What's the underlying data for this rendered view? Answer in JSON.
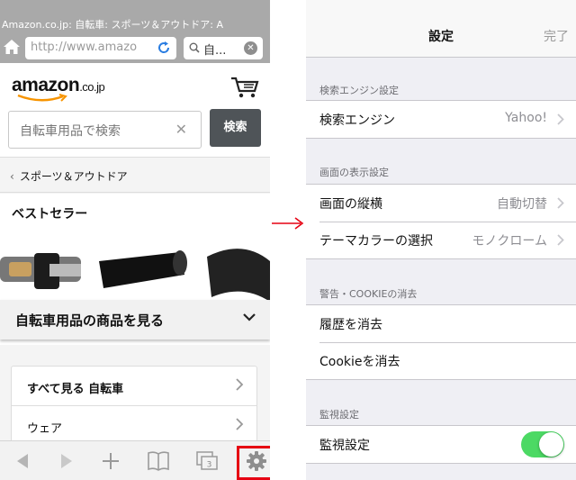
{
  "browser": {
    "page_title": "Amazon.co.jp: 自転車: スポーツ＆アウトドア: A",
    "url": "http://www.amazo",
    "search_text": "自...",
    "icons": [
      "home-icon",
      "reload-icon",
      "search-icon",
      "clear-icon"
    ]
  },
  "amazon": {
    "logo": "amazon",
    "logo_suffix": ".co.jp",
    "search_placeholder": "自転車用品で検索",
    "search_button": "検索",
    "breadcrumb": "スポーツ＆アウトドア",
    "bestseller_title": "ベストセラー",
    "see_products": "自転車用品の商品を見る",
    "categories": [
      {
        "label": "すべて見る  自転車"
      },
      {
        "label": "ウェア"
      }
    ]
  },
  "toolbar": {
    "items": [
      "back-icon",
      "forward-icon",
      "add-icon",
      "bookmarks-icon",
      "tabs-icon",
      "gear-icon"
    ],
    "tabs_count": "3",
    "highlight_color": "#e60012"
  },
  "settings": {
    "title": "設定",
    "done": "完了",
    "sections": [
      {
        "header": "検索エンジン設定",
        "rows": [
          {
            "label": "検索エンジン",
            "value": "Yahoo!"
          }
        ]
      },
      {
        "header": "画面の表示設定",
        "rows": [
          {
            "label": "画面の縦横",
            "value": "自動切替"
          },
          {
            "label": "テーマカラーの選択",
            "value": "モノクローム"
          }
        ]
      },
      {
        "header": "警告・COOKIEの消去",
        "rows": [
          {
            "label": "履歴を消去"
          },
          {
            "label": "Cookieを消去"
          }
        ]
      },
      {
        "header": "監視設定",
        "rows": [
          {
            "label": "監視設定",
            "toggle": true
          }
        ]
      }
    ],
    "toggle_color": "#4cd964"
  },
  "arrow_color": "#e60012"
}
